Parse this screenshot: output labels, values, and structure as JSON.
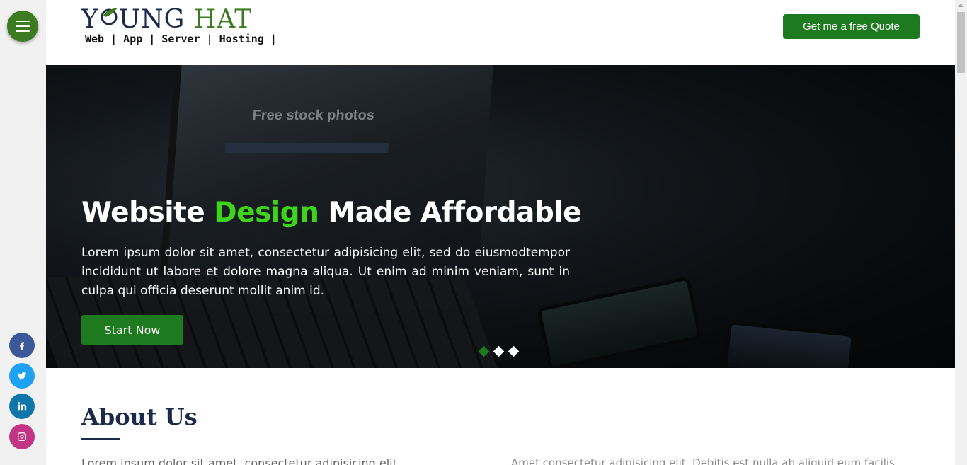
{
  "header": {
    "logo": {
      "title_first": "Y",
      "title_rest": "UNG",
      "title_accent": "HAT",
      "tagline": "Web | App | Server | Hosting |"
    },
    "quote_button": "Get me a free Quote"
  },
  "sidebar": {
    "menu_icon": "hamburger-icon",
    "social": [
      {
        "name": "facebook",
        "icon": "facebook-icon",
        "color": "#3b5998"
      },
      {
        "name": "twitter",
        "icon": "twitter-icon",
        "color": "#1da1f2"
      },
      {
        "name": "linkedin",
        "icon": "linkedin-icon",
        "color": "#0e76a8"
      },
      {
        "name": "instagram",
        "icon": "instagram-icon",
        "color": "#c13584"
      }
    ]
  },
  "hero": {
    "title_part1": "Website",
    "title_accent": "Design",
    "title_part2": "Made Affordable",
    "text": "Lorem ipsum dolor sit amet, consectetur adipisicing elit, sed do eiusmodtempor incididunt ut labore et dolore magna aliqua. Ut enim ad minim veniam, sunt in culpa qui officia deserunt mollit anim id.",
    "button": "Start Now",
    "slides": 3,
    "active_slide": 1,
    "background_image_text": "Free stock photos"
  },
  "about": {
    "title": "About Us",
    "left_text": "Lorem ipsum dolor sit amet, consectetur adipisicing elit",
    "right_text": "Amet consectetur adipisicing elit. Debitis est nulla ab aliquid eum facilis"
  },
  "colors": {
    "brand_green": "#1e7a1e",
    "accent_green": "#3dd41a",
    "navy": "#1b2a4a"
  }
}
